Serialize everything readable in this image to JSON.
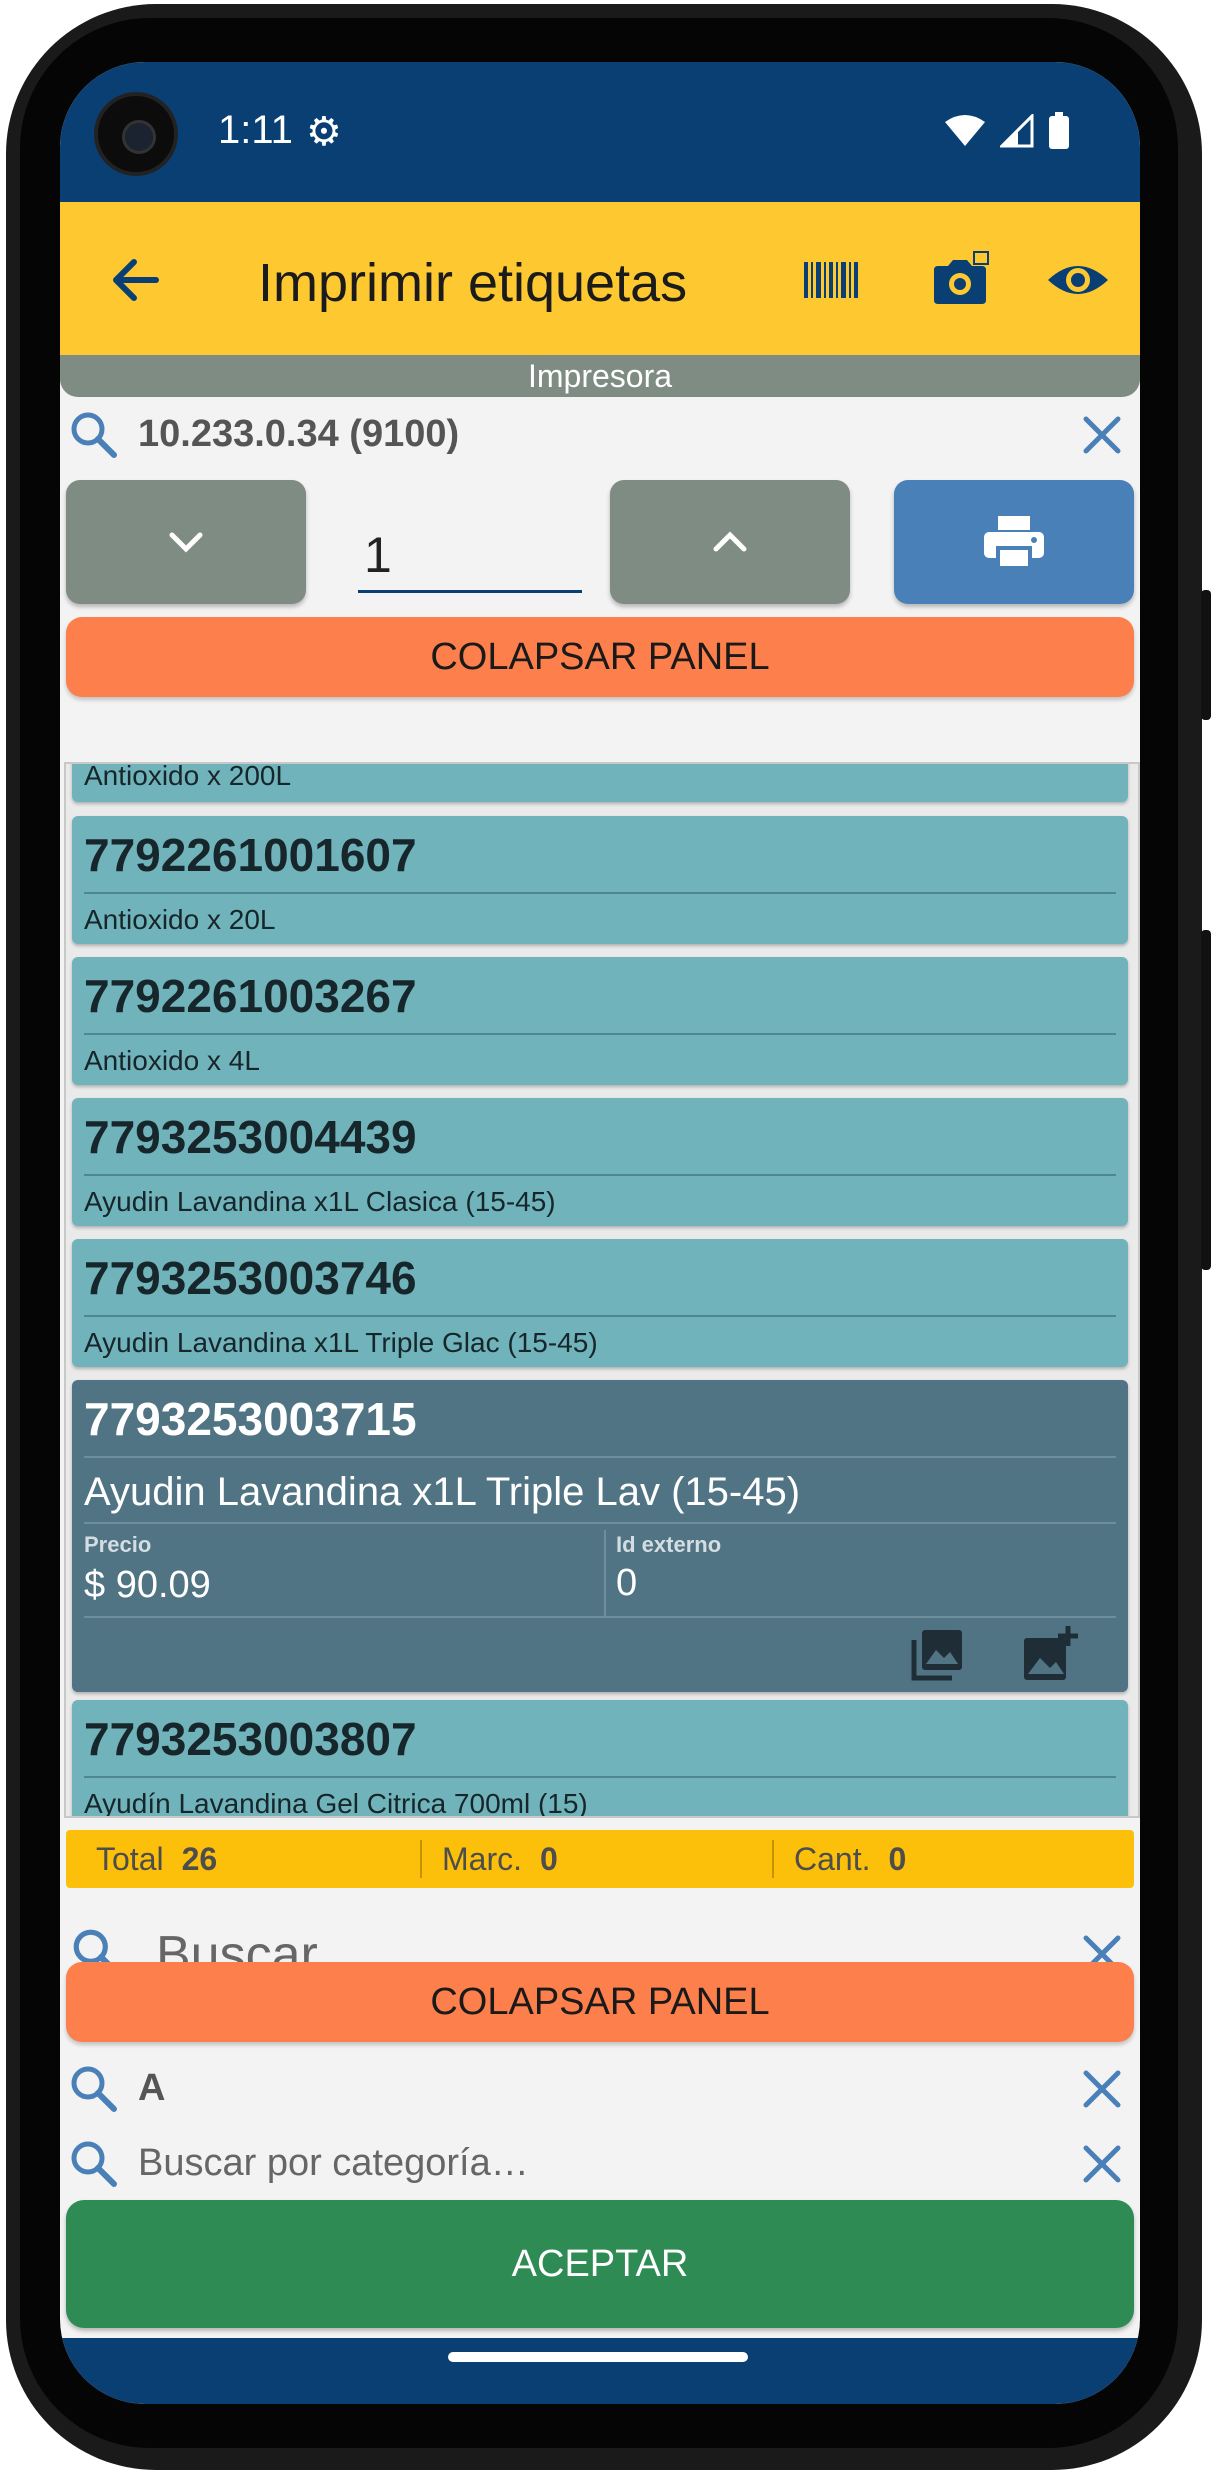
{
  "status": {
    "time": "1:11"
  },
  "appbar": {
    "title": "Imprimir etiquetas"
  },
  "printer": {
    "section_label": "Impresora",
    "address": "10.233.0.34 (9100)",
    "copies": "1"
  },
  "collapse_label": "COLAPSAR PANEL",
  "products": [
    {
      "code": "",
      "desc": "Antioxido x 200L"
    },
    {
      "code": "7792261001607",
      "desc": "Antioxido x 20L"
    },
    {
      "code": "7792261003267",
      "desc": "Antioxido x 4L"
    },
    {
      "code": "7793253004439",
      "desc": "Ayudin Lavandina x1L Clasica (15-45)"
    },
    {
      "code": "7793253003746",
      "desc": "Ayudin Lavandina x1L Triple Glac (15-45)"
    },
    {
      "code": "7793253003715",
      "desc": "Ayudin Lavandina x1L Triple Lav (15-45)"
    },
    {
      "code": "7793253003807",
      "desc": "Ayudín Lavandina Gel Citrica 700ml (15)"
    }
  ],
  "selected": {
    "price_label": "Precio",
    "price_value": "$ 90.09",
    "external_label": "Id externo",
    "external_value": "0"
  },
  "totals": {
    "total_label": "Total",
    "total_value": "26",
    "marked_label": "Marc.",
    "marked_value": "0",
    "qty_label": "Cant.",
    "qty_value": "0"
  },
  "search": {
    "placeholder": "Buscar…"
  },
  "filters": {
    "filter_value": "A",
    "category_placeholder": "Buscar por categoría…"
  },
  "accept_label": "ACEPTAR",
  "colors": {
    "statusbar": "#0a3f73",
    "appbar": "#fdc830",
    "accent_orange": "#fd7f4b",
    "item": "#70b3bb",
    "item_selected": "#507484",
    "accept": "#2e8b53",
    "print_button": "#4a80b8"
  }
}
